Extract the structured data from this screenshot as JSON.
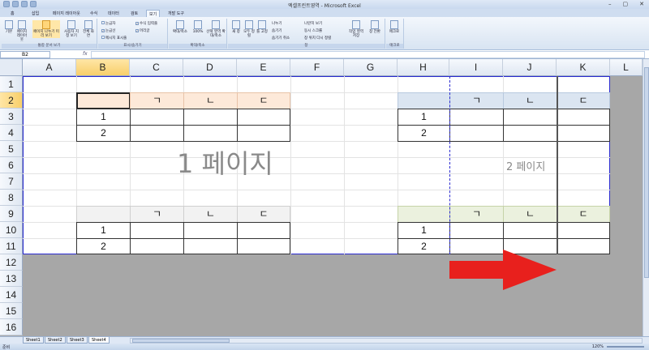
{
  "window": {
    "title": "엑셀프린트영역 - Microsoft Excel",
    "controls": [
      "–",
      "▢",
      "✕"
    ]
  },
  "ribbon_tabs": [
    "홈",
    "삽입",
    "페이지 레이아웃",
    "수식",
    "데이터",
    "검토",
    "보기",
    "개발 도구"
  ],
  "active_tab": "보기",
  "ribbon": {
    "views_group": {
      "label": "통합 문서 보기",
      "buttons": [
        "기본",
        "페이지 레이아웃",
        "페이지 나누기 미리 보기",
        "사용자 지정 보기",
        "전체 화면"
      ]
    },
    "show_group": {
      "label": "표시/숨기기",
      "checks": [
        {
          "label": "눈금자",
          "checked": false
        },
        {
          "label": "눈금선",
          "checked": true
        },
        {
          "label": "메시지 표시줄",
          "checked": false
        },
        {
          "label": "수식 입력줄",
          "checked": true
        },
        {
          "label": "머리글",
          "checked": true
        }
      ]
    },
    "zoom_group": {
      "label": "확대/축소",
      "buttons": [
        "확대/축소",
        "100%",
        "선택 영역 확대/축소"
      ]
    },
    "window_group": {
      "label": "창",
      "buttons": [
        "새 창",
        "모두 정렬",
        "틀 고정"
      ],
      "small": [
        "나누기",
        "숨기기",
        "숨기기 취소",
        "나란히 보기",
        "동시 스크롤",
        "창 위치 다시 정렬",
        "작업 영역 저장",
        "창 전환"
      ]
    },
    "macro_group": {
      "label": "매크로",
      "buttons": [
        "매크로"
      ]
    }
  },
  "formula_bar": {
    "name_box": "B2",
    "fx": "fx",
    "value": ""
  },
  "columns": [
    "A",
    "B",
    "C",
    "D",
    "E",
    "F",
    "G",
    "H",
    "I",
    "J",
    "K",
    "L"
  ],
  "active_column": "B",
  "rows": [
    "1",
    "2",
    "3",
    "4",
    "5",
    "6",
    "7",
    "8",
    "9",
    "10",
    "11",
    "12",
    "13",
    "14",
    "15",
    "16"
  ],
  "active_row": "2",
  "tables": {
    "header_marks": [
      "ㄱ",
      "ㄴ",
      "ㄷ"
    ],
    "row_numbers": [
      "1",
      "2"
    ]
  },
  "watermarks": {
    "page1": "1 페이지",
    "page2": "2 페이지"
  },
  "sheet_tabs": [
    "Sheet1",
    "Sheet2",
    "Sheet3",
    "Sheet4"
  ],
  "active_sheet": "Sheet4",
  "status": {
    "left": "준비",
    "zoom": "120%"
  },
  "colors": {
    "header_orange": "#fde9d9",
    "header_blue": "#dbe5f1",
    "header_gray": "#f2f2f2",
    "header_green": "#ebf1de",
    "arrow_red": "#e8201d",
    "page_break_blue": "#2a2ad0"
  }
}
